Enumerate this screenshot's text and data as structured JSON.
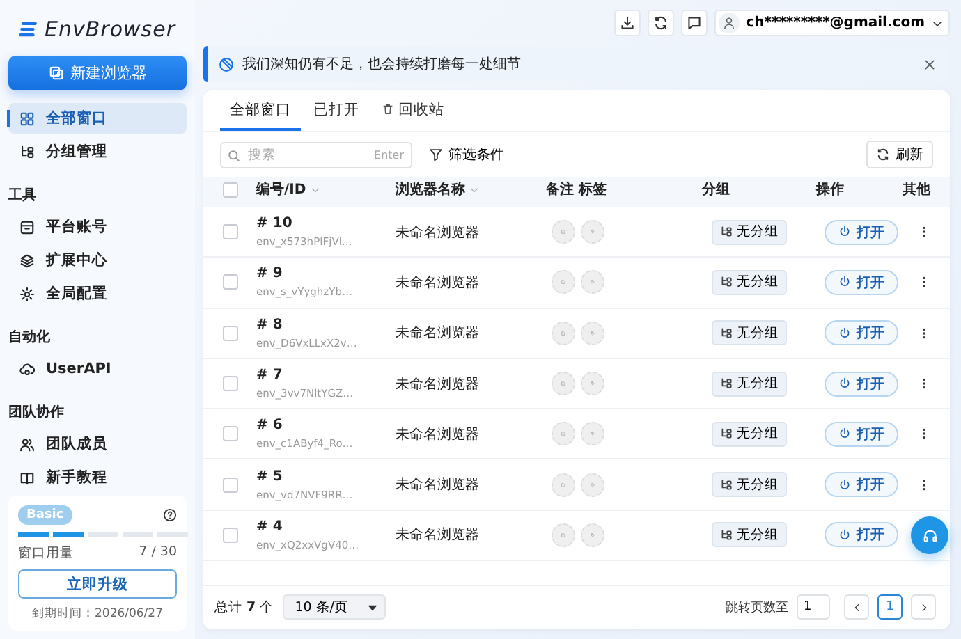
{
  "sidebar": {
    "logo": "EnvBrowser",
    "new_button": "新建浏览器",
    "sections": [
      {
        "items": [
          {
            "label": "全部窗口",
            "selected": true
          },
          {
            "label": "分组管理",
            "selected": false
          }
        ]
      },
      {
        "title": "工具",
        "items": [
          {
            "label": "平台账号",
            "selected": false
          },
          {
            "label": "扩展中心",
            "selected": false
          },
          {
            "label": "全局配置",
            "selected": false
          }
        ]
      },
      {
        "title": "自动化",
        "items": [
          {
            "label": "UserAPI",
            "selected": false
          }
        ]
      },
      {
        "title": "团队协作",
        "items": [
          {
            "label": "团队成员",
            "selected": false
          },
          {
            "label": "新手教程",
            "selected": false
          }
        ]
      }
    ],
    "plan": {
      "badge": "Basic",
      "level": 0.4,
      "usage_label": "窗口用量",
      "usage": "7 / 30",
      "upgrade_button": "立即升级",
      "expiry": "到期时间：2026/06/27"
    }
  },
  "topbar": {
    "account": "ch*********@gmail.com"
  },
  "notice": {
    "text": "我们深知仍有不足，也会持续打磨每一处细节"
  },
  "tabs": [
    {
      "label": "全部窗口",
      "selected": true
    },
    {
      "label": "已打开",
      "selected": false
    },
    {
      "label": "回收站",
      "selected": false
    }
  ],
  "toolbar": {
    "search_placeholder": "搜索",
    "search_hint": "Enter",
    "filter": "筛选条件",
    "refresh": "刷新"
  },
  "table": {
    "header_checked": false,
    "columns": [
      {
        "label": "编号/ID",
        "sortable": true
      },
      {
        "label": "浏览器名称",
        "sortable": true
      },
      {
        "label": "备注 标签",
        "sortable": false
      },
      {
        "label": "分组",
        "sortable": false
      },
      {
        "label": "操作",
        "sortable": false
      },
      {
        "label": "其他",
        "sortable": false
      }
    ],
    "rows": [
      {
        "checked": false,
        "number": "# 10",
        "id": "env_x573hPIFjVl…",
        "name": "未命名浏览器",
        "group": "无分组",
        "action": "打开",
        "menu_shown": true
      },
      {
        "checked": false,
        "number": "# 9",
        "id": "env_s_vYyghzYb…",
        "name": "未命名浏览器",
        "group": "无分组",
        "action": "打开",
        "menu_shown": true
      },
      {
        "checked": false,
        "number": "# 8",
        "id": "env_D6VxLLxX2v…",
        "name": "未命名浏览器",
        "group": "无分组",
        "action": "打开",
        "menu_shown": true
      },
      {
        "checked": false,
        "number": "# 7",
        "id": "env_3vv7NltYGZ…",
        "name": "未命名浏览器",
        "group": "无分组",
        "action": "打开",
        "menu_shown": true
      },
      {
        "checked": false,
        "number": "# 6",
        "id": "env_c1AByf4_Ro…",
        "name": "未命名浏览器",
        "group": "无分组",
        "action": "打开",
        "menu_shown": true
      },
      {
        "checked": false,
        "number": "# 5",
        "id": "env_vd7NVF9RR…",
        "name": "未命名浏览器",
        "group": "无分组",
        "action": "打开",
        "menu_shown": true
      },
      {
        "checked": false,
        "number": "# 4",
        "id": "env_xQ2xxVgV40…",
        "name": "未命名浏览器",
        "group": "无分组",
        "action": "打开",
        "menu_shown": false
      }
    ]
  },
  "footer": {
    "total": "总计 **7** 个",
    "page_size": "10 条/页",
    "jump_label": "跳转页数至",
    "jump_value": "1",
    "pages": [
      {
        "label": "1",
        "selected": true
      }
    ]
  }
}
